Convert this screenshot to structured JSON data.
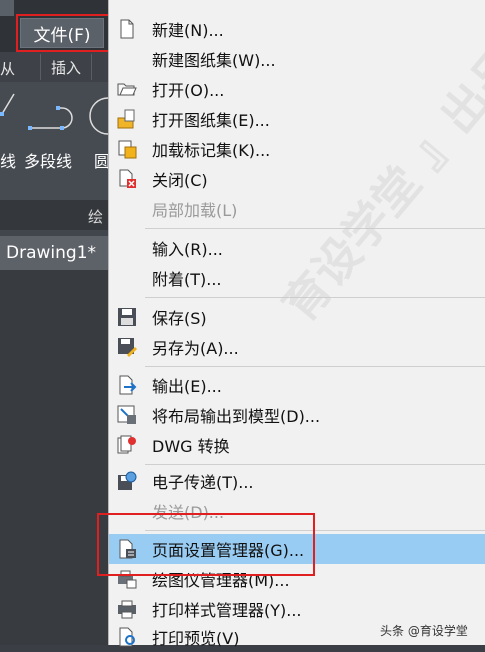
{
  "left": {
    "file_button": "文件(F)",
    "tab_fragment": "从",
    "tab_insert": "插入",
    "tool_line_fragment": "线",
    "tool_polyline": "多段线",
    "tool_circle_fragment": "圆",
    "panel_title_fragment": "绘",
    "doc_tab": "Drawing1*"
  },
  "menu": {
    "items": [
      {
        "label": "新建(N)...",
        "icon": "new-file-icon"
      },
      {
        "label": "新建图纸集(W)...",
        "icon": ""
      },
      {
        "label": "打开(O)...",
        "icon": "open-folder-icon"
      },
      {
        "label": "打开图纸集(E)...",
        "icon": "open-sheetset-icon"
      },
      {
        "label": "加载标记集(K)...",
        "icon": "markup-set-icon"
      },
      {
        "label": "关闭(C)",
        "icon": "close-file-icon"
      },
      {
        "label": "局部加载(L)",
        "icon": "",
        "disabled": true
      },
      {
        "label": "输入(R)...",
        "icon": ""
      },
      {
        "label": "附着(T)...",
        "icon": ""
      },
      {
        "label": "保存(S)",
        "icon": "save-icon"
      },
      {
        "label": "另存为(A)...",
        "icon": "save-as-icon"
      },
      {
        "label": "输出(E)...",
        "icon": "export-icon"
      },
      {
        "label": "将布局输出到模型(D)...",
        "icon": "layout-export-icon"
      },
      {
        "label": "DWG 转换",
        "icon": "dwg-convert-icon"
      },
      {
        "label": "电子传递(T)...",
        "icon": "etransmit-icon"
      },
      {
        "label": "发送(D)...",
        "icon": "",
        "disabled": true
      },
      {
        "label": "页面设置管理器(G)...",
        "icon": "page-setup-icon",
        "highlighted": true
      },
      {
        "label": "绘图仪管理器(M)...",
        "icon": "plotter-icon"
      },
      {
        "label": "打印样式管理器(Y)...",
        "icon": "plot-style-icon"
      },
      {
        "label": "打印预览(V)",
        "icon": "print-preview-icon"
      }
    ]
  },
  "watermark": "育设学堂 』出品",
  "credit": "头条 @育设学堂",
  "colors": {
    "highlight": "#99ccf2",
    "red_outline": "#e02020",
    "menu_bg": "#f1f1f1"
  }
}
